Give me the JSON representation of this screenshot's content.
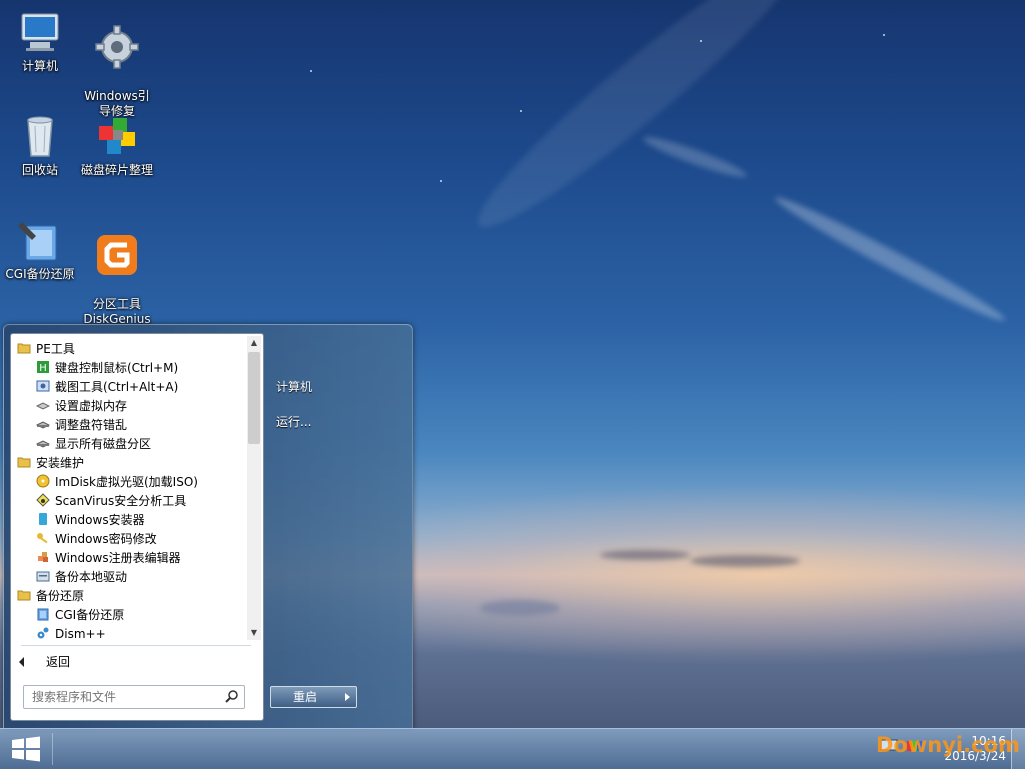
{
  "desktop": {
    "icons": [
      {
        "label": "计算机"
      },
      {
        "label": "Windows引\n导修复"
      },
      {
        "label": "回收站"
      },
      {
        "label": "磁盘碎片整理"
      },
      {
        "label": "CGI备份还原"
      },
      {
        "label": "分区工具\nDiskGenius"
      }
    ]
  },
  "start_menu": {
    "programs": [
      {
        "label": "PE工具",
        "icon": "folder-icon"
      },
      {
        "label": "键盘控制鼠标(Ctrl+M)",
        "icon": "keyboard-mouse-icon"
      },
      {
        "label": "截图工具(Ctrl+Alt+A)",
        "icon": "screenshot-icon"
      },
      {
        "label": "设置虚拟内存",
        "icon": "memory-icon"
      },
      {
        "label": "调整盘符错乱",
        "icon": "drive-icon"
      },
      {
        "label": "显示所有磁盘分区",
        "icon": "drive-icon"
      },
      {
        "label": "安装维护",
        "icon": "folder-icon"
      },
      {
        "label": "ImDisk虚拟光驱(加载ISO)",
        "icon": "disc-icon"
      },
      {
        "label": "ScanVirus安全分析工具",
        "icon": "shield-icon"
      },
      {
        "label": "Windows安装器",
        "icon": "installer-icon"
      },
      {
        "label": "Windows密码修改",
        "icon": "key-icon"
      },
      {
        "label": "Windows注册表编辑器",
        "icon": "registry-icon"
      },
      {
        "label": "备份本地驱动",
        "icon": "driver-icon"
      },
      {
        "label": "备份还原",
        "icon": "folder-icon"
      },
      {
        "label": "CGI备份还原",
        "icon": "cgi-icon"
      },
      {
        "label": "Dism++",
        "icon": "gear-icon"
      }
    ],
    "back_label": "返回",
    "search_placeholder": "搜索程序和文件",
    "right_links": [
      "计算机",
      "运行..."
    ],
    "restart_label": "重启"
  },
  "taskbar": {
    "time": "10:16",
    "date": "2016/3/24"
  },
  "watermark": "Downyi.com",
  "colors": {
    "taskbar": "#5a7aa3",
    "menu_pane": "#ffffff",
    "watermark": "#ff9614"
  }
}
